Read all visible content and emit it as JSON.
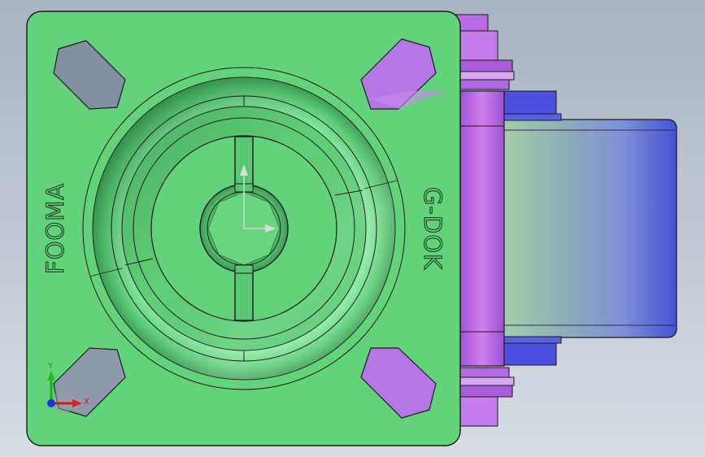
{
  "model": {
    "engraving_left": "FOOMA",
    "engraving_right": "G-DOK"
  },
  "triad": {
    "x_label": "X",
    "y_label": "Y"
  },
  "colors": {
    "background_top": "#a9b4c2",
    "background_bottom": "#d9dde4",
    "plate": "#62d37b",
    "plate_edge": "#1a1a1a",
    "swivel_body": "#c97be8",
    "wheel_blue": "#4b56d8",
    "wheel_light": "#9bc7a3",
    "triad_x": "#e02020",
    "triad_y": "#20b020",
    "triad_z": "#2030e0"
  }
}
